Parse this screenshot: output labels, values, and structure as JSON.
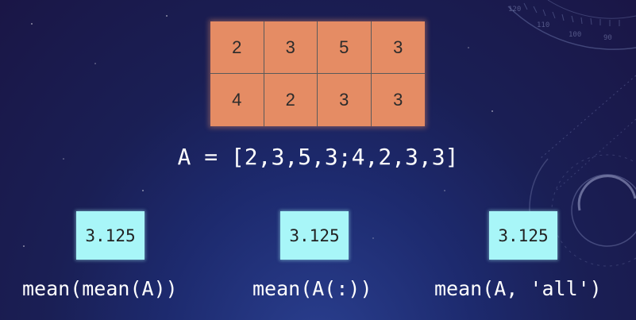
{
  "matrix": {
    "rows": [
      [
        "2",
        "3",
        "5",
        "3"
      ],
      [
        "4",
        "2",
        "3",
        "3"
      ]
    ]
  },
  "assignment": "A = [2,3,5,3;4,2,3,3]",
  "examples": [
    {
      "result": "3.125",
      "expression": "mean(mean(A))"
    },
    {
      "result": "3.125",
      "expression": "mean(A(:))"
    },
    {
      "result": "3.125",
      "expression": "mean(A, 'all')"
    }
  ],
  "colors": {
    "matrix_fill": "#e58c64",
    "result_fill": "#a8f6f8",
    "background": "#1a1f55",
    "text": "#ffffff"
  }
}
